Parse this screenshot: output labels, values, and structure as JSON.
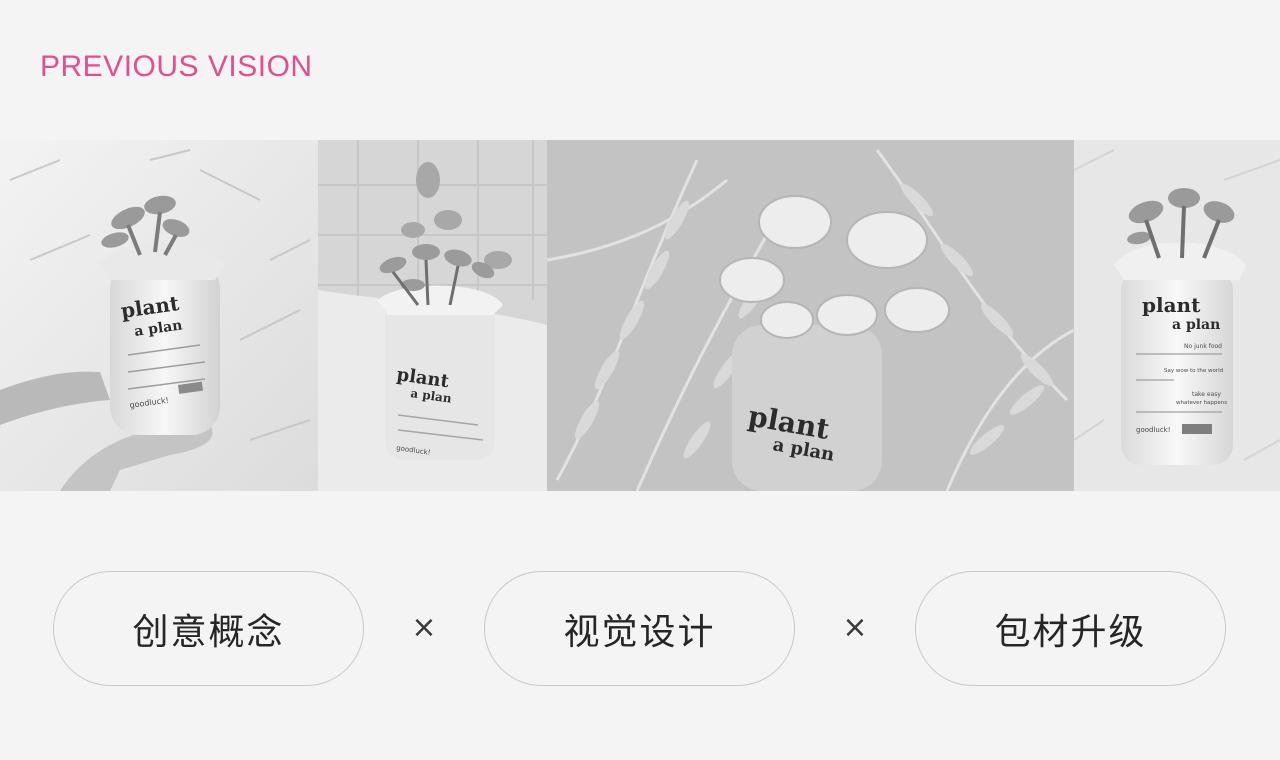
{
  "header": {
    "title": "PREVIOUS VISION"
  },
  "colors": {
    "accent": "#e0508f",
    "background": "#f4f4f4",
    "pill_border": "#c9c9c9",
    "pill_text": "#262626"
  },
  "photos": [
    {
      "package": {
        "brand_line1": "plant",
        "brand_line2": "a plan",
        "footer": "goodluck!"
      }
    },
    {
      "package": {
        "brand_line1": "plant",
        "brand_line2": "a plan",
        "footer": "goodluck!"
      }
    },
    {
      "package": {
        "brand_line1": "plant",
        "brand_line2": "a plan"
      }
    },
    {
      "package": {
        "brand_line1": "plant",
        "brand_line2": "a plan",
        "line_a": "No junk food",
        "line_b": "Say wow to the world",
        "line_c": "take easy",
        "line_d": "whatever happens",
        "footer": "goodluck!"
      }
    }
  ],
  "concepts": [
    {
      "label": "创意概念"
    },
    {
      "label": "视觉设计"
    },
    {
      "label": "包材升级"
    }
  ],
  "separators": [
    "×",
    "×"
  ]
}
